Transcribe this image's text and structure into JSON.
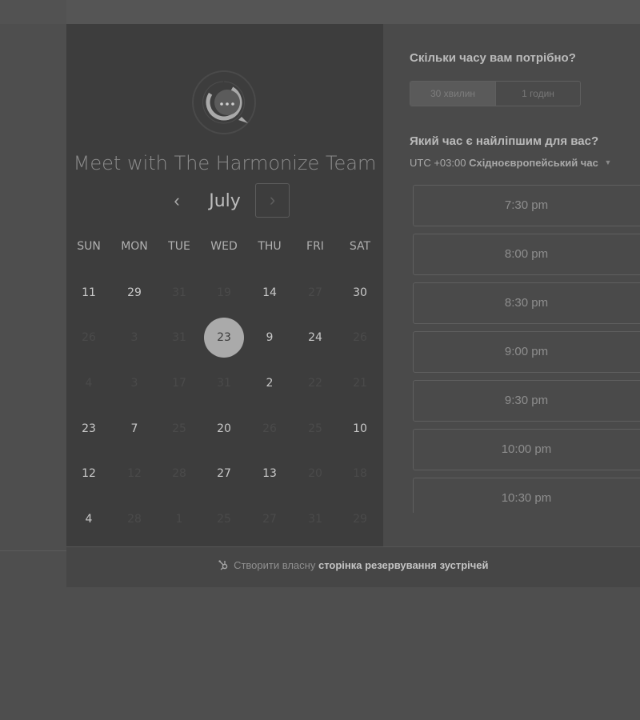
{
  "duration_question": "Скільки часу вам потрібно?",
  "durations": [
    {
      "label": "30 хвилин",
      "active": true
    },
    {
      "label": "1 годин",
      "active": false
    }
  ],
  "time_question": "Який час є найліпшим для вас?",
  "timezone": {
    "offset": "UTC +03:00",
    "name": "Східноєвропейський час"
  },
  "title": "Meet with The Harmonize Team",
  "calendar": {
    "month": "July",
    "prev_glyph": "‹",
    "next_glyph": "›",
    "weekdays": [
      "SUN",
      "MON",
      "TUE",
      "WED",
      "THU",
      "FRI",
      "SAT"
    ],
    "weeks": [
      [
        {
          "d": "11",
          "on": true
        },
        {
          "d": "29",
          "on": true
        },
        {
          "d": "31",
          "on": false
        },
        {
          "d": "19",
          "on": false
        },
        {
          "d": "14",
          "on": true
        },
        {
          "d": "27",
          "on": false
        },
        {
          "d": "30",
          "on": true
        }
      ],
      [
        {
          "d": "26",
          "on": false
        },
        {
          "d": "3",
          "on": false
        },
        {
          "d": "31",
          "on": false
        },
        {
          "d": "23",
          "on": true,
          "selected": true
        },
        {
          "d": "9",
          "on": true
        },
        {
          "d": "24",
          "on": true
        },
        {
          "d": "26",
          "on": false
        }
      ],
      [
        {
          "d": "4",
          "on": false
        },
        {
          "d": "3",
          "on": false
        },
        {
          "d": "17",
          "on": false
        },
        {
          "d": "31",
          "on": false
        },
        {
          "d": "2",
          "on": true
        },
        {
          "d": "22",
          "on": false
        },
        {
          "d": "21",
          "on": false
        }
      ],
      [
        {
          "d": "23",
          "on": true
        },
        {
          "d": "7",
          "on": true
        },
        {
          "d": "25",
          "on": false
        },
        {
          "d": "20",
          "on": true
        },
        {
          "d": "26",
          "on": false
        },
        {
          "d": "25",
          "on": false
        },
        {
          "d": "10",
          "on": true
        }
      ],
      [
        {
          "d": "12",
          "on": true
        },
        {
          "d": "12",
          "on": false
        },
        {
          "d": "28",
          "on": false
        },
        {
          "d": "27",
          "on": true
        },
        {
          "d": "13",
          "on": true
        },
        {
          "d": "20",
          "on": false
        },
        {
          "d": "18",
          "on": false
        }
      ],
      [
        {
          "d": "4",
          "on": true
        },
        {
          "d": "28",
          "on": false
        },
        {
          "d": "1",
          "on": false
        },
        {
          "d": "25",
          "on": false
        },
        {
          "d": "27",
          "on": false
        },
        {
          "d": "31",
          "on": false
        },
        {
          "d": "29",
          "on": false
        }
      ]
    ]
  },
  "time_slots": [
    "7:30 pm",
    "8:00 pm",
    "8:30 pm",
    "9:00 pm",
    "9:30 pm",
    "10:00 pm",
    "10:30 pm"
  ],
  "footer": {
    "prefix": "Створити власну",
    "link": "сторінка резервування зустрічей"
  },
  "icons": {
    "avatar": "chat-bubble-icon",
    "footer": "hubspot-sprocket-icon",
    "tz_caret": "caret-down-icon"
  }
}
